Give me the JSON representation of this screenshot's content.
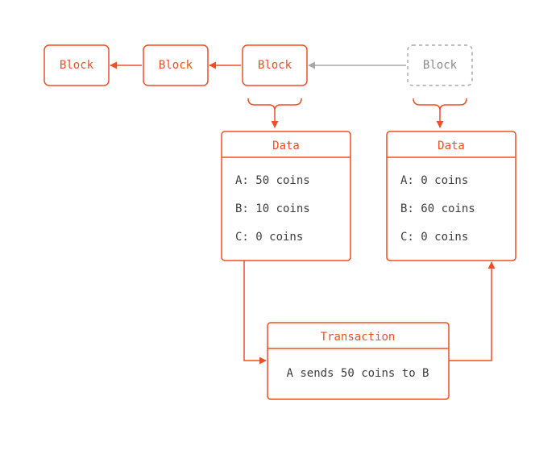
{
  "colors": {
    "accent": "#f04e23",
    "muted": "#a8a8a8",
    "text": "#3d3d3d"
  },
  "blocks": {
    "b1": "Block",
    "b2": "Block",
    "b3": "Block",
    "b4": "Block"
  },
  "data_left": {
    "title": "Data",
    "rows": [
      "A: 50 coins",
      "B: 10 coins",
      "C: 0 coins"
    ]
  },
  "data_right": {
    "title": "Data",
    "rows": [
      "A: 0 coins",
      "B: 60 coins",
      "C: 0 coins"
    ]
  },
  "transaction": {
    "title": "Transaction",
    "body": "A sends 50 coins to B"
  }
}
